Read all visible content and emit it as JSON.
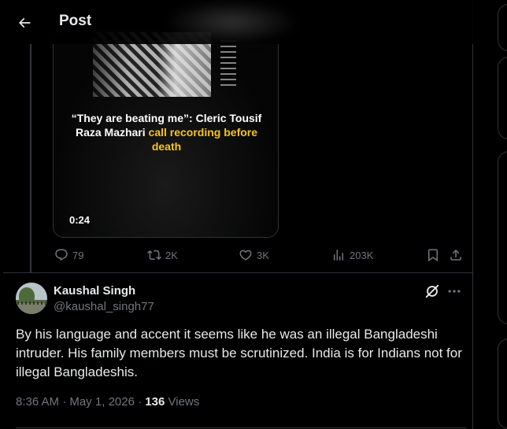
{
  "header": {
    "title": "Post"
  },
  "video": {
    "caption_white": "“They are beating me”: Cleric Tousif Raza Mazhari ",
    "caption_highlight": "call recording before death",
    "duration": "0:24"
  },
  "actions": {
    "replies": "79",
    "reposts": "2K",
    "likes": "3K",
    "views": "203K"
  },
  "reply": {
    "author_name": "Kaushal Singh",
    "author_handle": "@kaushal_singh77",
    "text": "By his language and accent it seems like he was an illegal Bangladeshi intruder. His family members must be scrutinized. India is for Indians not for illegal Bangladeshis.",
    "time": "8:36 AM",
    "date": "May 1, 2026",
    "views_count": "136",
    "views_label": "Views"
  },
  "colors": {
    "background": "#000000",
    "text": "#e7e9ea",
    "muted": "#71767b",
    "highlight": "#f7c325",
    "border": "#2f3336"
  }
}
